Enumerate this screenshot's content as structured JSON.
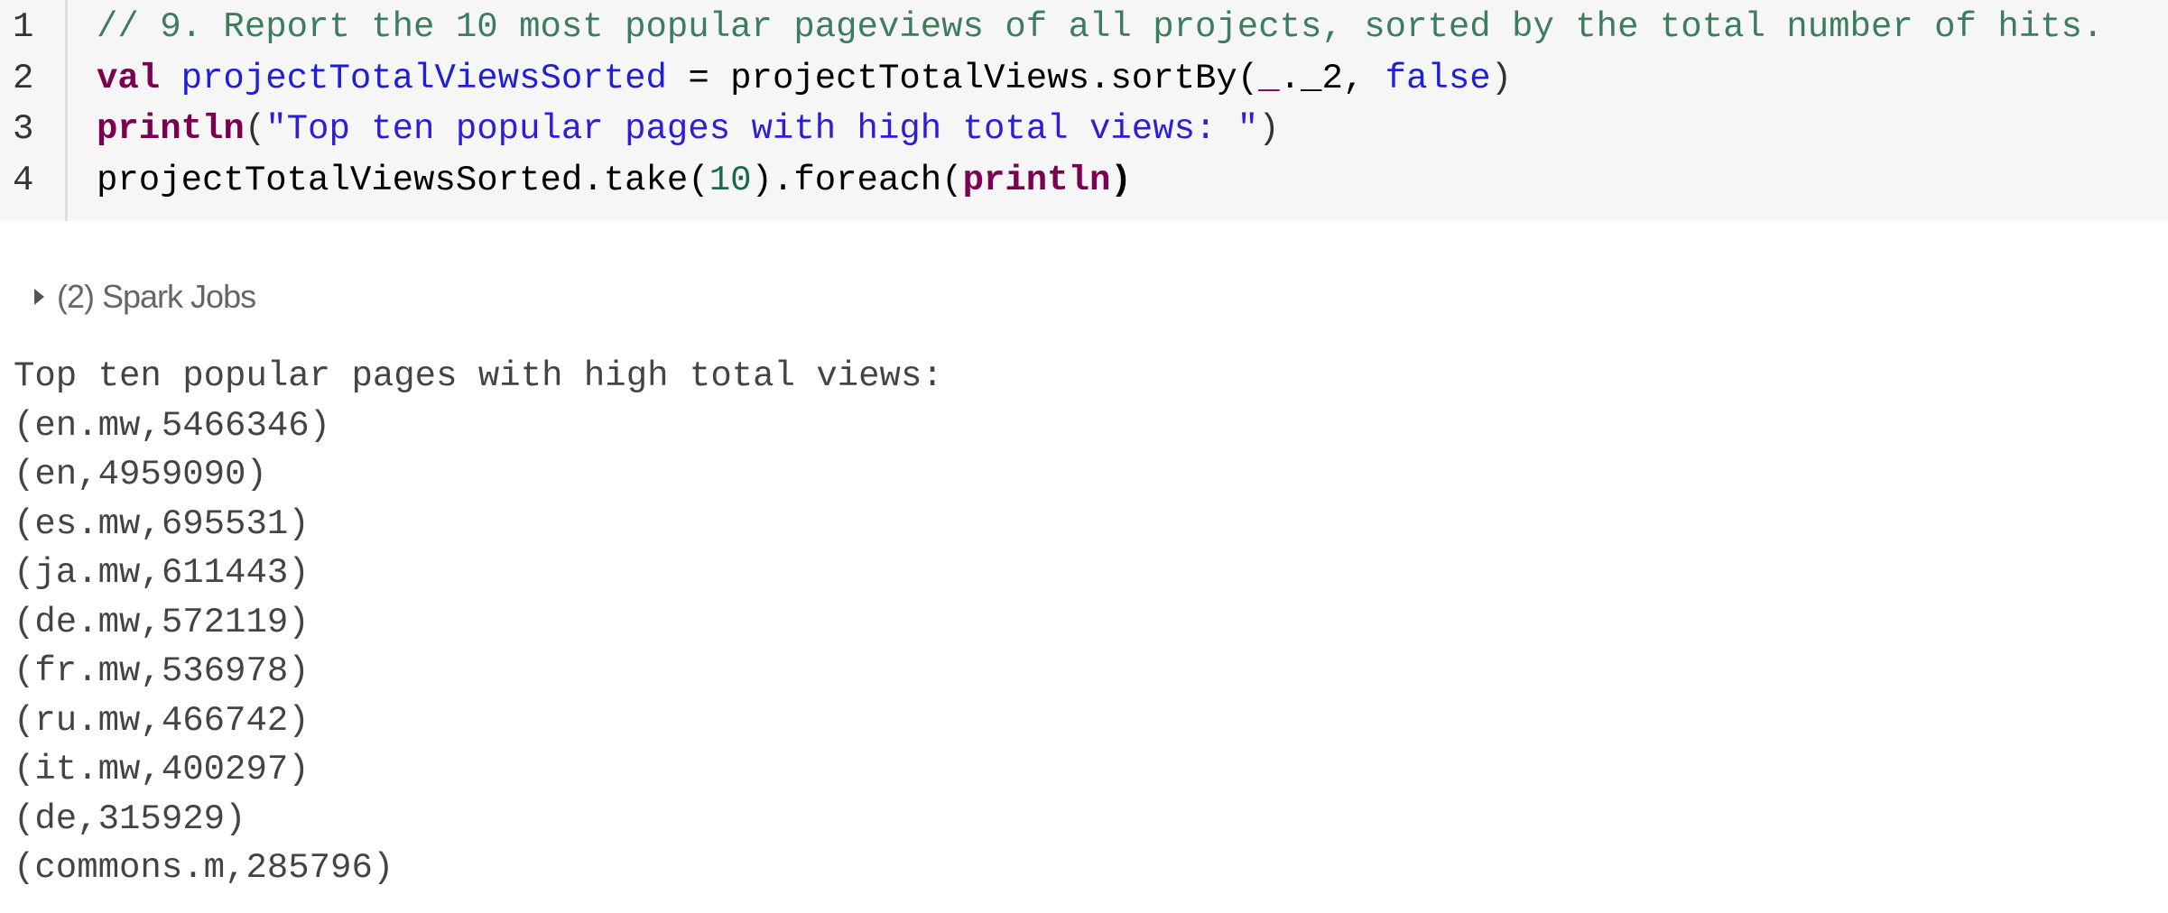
{
  "code": {
    "line_numbers": [
      "1",
      "2",
      "3",
      "4"
    ],
    "line1": {
      "comment": "// 9. Report the 10 most popular pageviews of all projects, sorted by the total number of hits."
    },
    "line2": {
      "kw": "val",
      "var": "projectTotalViewsSorted",
      "rest1": " = projectTotalViews.sortBy(",
      "underscore": "_",
      "rest2": "._2, ",
      "false": "false",
      "close": ")"
    },
    "line3": {
      "kw": "println",
      "open": "(",
      "string": "\"Top ten popular pages with high total views: \"",
      "close": ")"
    },
    "line4": {
      "pre": "projectTotalViewsSorted.take(",
      "num": "10",
      "mid": ").foreach(",
      "kw": "println",
      "close": ")"
    }
  },
  "spark_jobs": {
    "label": "(2) Spark Jobs",
    "icon": "caret-right-icon"
  },
  "output": {
    "header": "Top ten popular pages with high total views:",
    "lines": [
      "(en.mw,5466346)",
      "(en,4959090)",
      "(es.mw,695531)",
      "(ja.mw,611443)",
      "(de.mw,572119)",
      "(fr.mw,536978)",
      "(ru.mw,466742)",
      "(it.mw,400297)",
      "(de,315929)",
      "(commons.m,285796)"
    ]
  }
}
